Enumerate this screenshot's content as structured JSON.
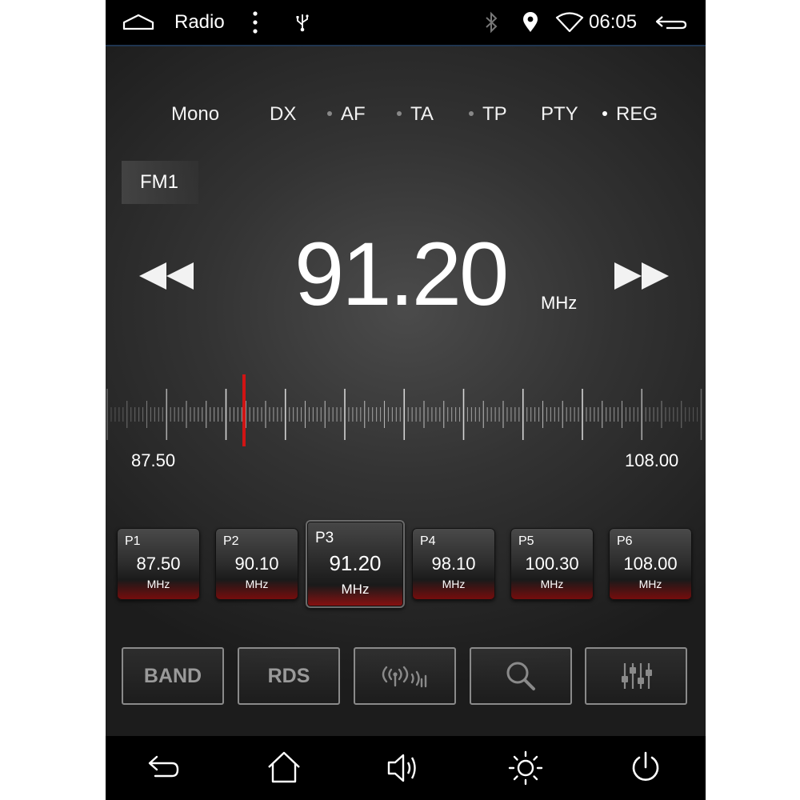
{
  "status_bar": {
    "app_title": "Radio",
    "time": "06:05",
    "icons": [
      "home-icon",
      "overflow-menu-icon",
      "usb-icon",
      "bluetooth-icon",
      "location-icon",
      "wifi-icon",
      "back-arrow-icon"
    ]
  },
  "rds_flags": [
    {
      "label": "Mono",
      "dot": false
    },
    {
      "label": "DX",
      "dot": false
    },
    {
      "label": "AF",
      "dot": true,
      "dot_color": "#888888"
    },
    {
      "label": "TA",
      "dot": true,
      "dot_color": "#888888"
    },
    {
      "label": "TP",
      "dot": true,
      "dot_color": "#888888"
    },
    {
      "label": "PTY",
      "dot": false
    },
    {
      "label": "REG",
      "dot": true,
      "dot_color": "#ffffff"
    }
  ],
  "band": "FM1",
  "tuner": {
    "frequency": "91.20",
    "unit": "MHz",
    "range_min": "87.50",
    "range_max": "108.00",
    "needle_color": "#d01414"
  },
  "presets": [
    {
      "num": "P1",
      "freq": "87.50",
      "unit": "MHz",
      "active": false
    },
    {
      "num": "P2",
      "freq": "90.10",
      "unit": "MHz",
      "active": false
    },
    {
      "num": "P3",
      "freq": "91.20",
      "unit": "MHz",
      "active": true
    },
    {
      "num": "P4",
      "freq": "98.10",
      "unit": "MHz",
      "active": false
    },
    {
      "num": "P5",
      "freq": "100.30",
      "unit": "MHz",
      "active": false
    },
    {
      "num": "P6",
      "freq": "108.00",
      "unit": "MHz",
      "active": false
    }
  ],
  "controls": {
    "band_label": "BAND",
    "rds_label": "RDS",
    "icons": [
      "signal-broadcast-icon",
      "search-icon",
      "equalizer-icon"
    ]
  },
  "nav_bar": {
    "icons": [
      "back-icon",
      "home-icon",
      "volume-icon",
      "brightness-icon",
      "power-icon"
    ]
  },
  "colors": {
    "accent_red": "#b01010",
    "background": "#333333"
  }
}
